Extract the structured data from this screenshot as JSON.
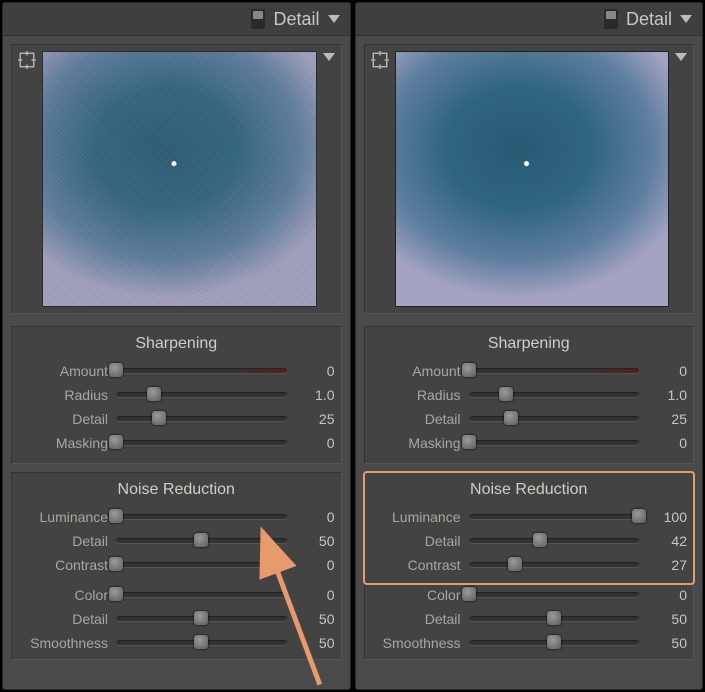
{
  "panels": [
    {
      "header": {
        "title": "Detail"
      },
      "preview": {
        "noisy": true
      },
      "sections": [
        {
          "title": "Sharpening",
          "sliders": [
            {
              "label": "Amount",
              "value": "0",
              "pos": 0,
              "red": true
            },
            {
              "label": "Radius",
              "value": "1.0",
              "pos": 22
            },
            {
              "label": "Detail",
              "value": "25",
              "pos": 25
            },
            {
              "label": "Masking",
              "value": "0",
              "pos": 0
            }
          ]
        },
        {
          "title": "Noise Reduction",
          "sliders": [
            {
              "label": "Luminance",
              "value": "0",
              "pos": 0
            },
            {
              "label": "Detail",
              "value": "50",
              "pos": 50
            },
            {
              "label": "Contrast",
              "value": "0",
              "pos": 0
            }
          ]
        },
        {
          "title": "",
          "sliders": [
            {
              "label": "Color",
              "value": "0",
              "pos": 0
            },
            {
              "label": "Detail",
              "value": "50",
              "pos": 50
            },
            {
              "label": "Smoothness",
              "value": "50",
              "pos": 50
            }
          ]
        }
      ]
    },
    {
      "header": {
        "title": "Detail"
      },
      "preview": {
        "noisy": false
      },
      "sections": [
        {
          "title": "Sharpening",
          "sliders": [
            {
              "label": "Amount",
              "value": "0",
              "pos": 0,
              "red": true
            },
            {
              "label": "Radius",
              "value": "1.0",
              "pos": 22
            },
            {
              "label": "Detail",
              "value": "25",
              "pos": 25
            },
            {
              "label": "Masking",
              "value": "0",
              "pos": 0
            }
          ]
        },
        {
          "title": "Noise Reduction",
          "highlight": true,
          "sliders": [
            {
              "label": "Luminance",
              "value": "100",
              "pos": 100
            },
            {
              "label": "Detail",
              "value": "42",
              "pos": 42
            },
            {
              "label": "Contrast",
              "value": "27",
              "pos": 27
            }
          ]
        },
        {
          "title": "",
          "sliders": [
            {
              "label": "Color",
              "value": "0",
              "pos": 0
            },
            {
              "label": "Detail",
              "value": "50",
              "pos": 50
            },
            {
              "label": "Smoothness",
              "value": "50",
              "pos": 50
            }
          ]
        }
      ]
    }
  ],
  "annotation": {
    "arrow_color": "#e79a6c",
    "highlight_color": "#e79a6c"
  }
}
